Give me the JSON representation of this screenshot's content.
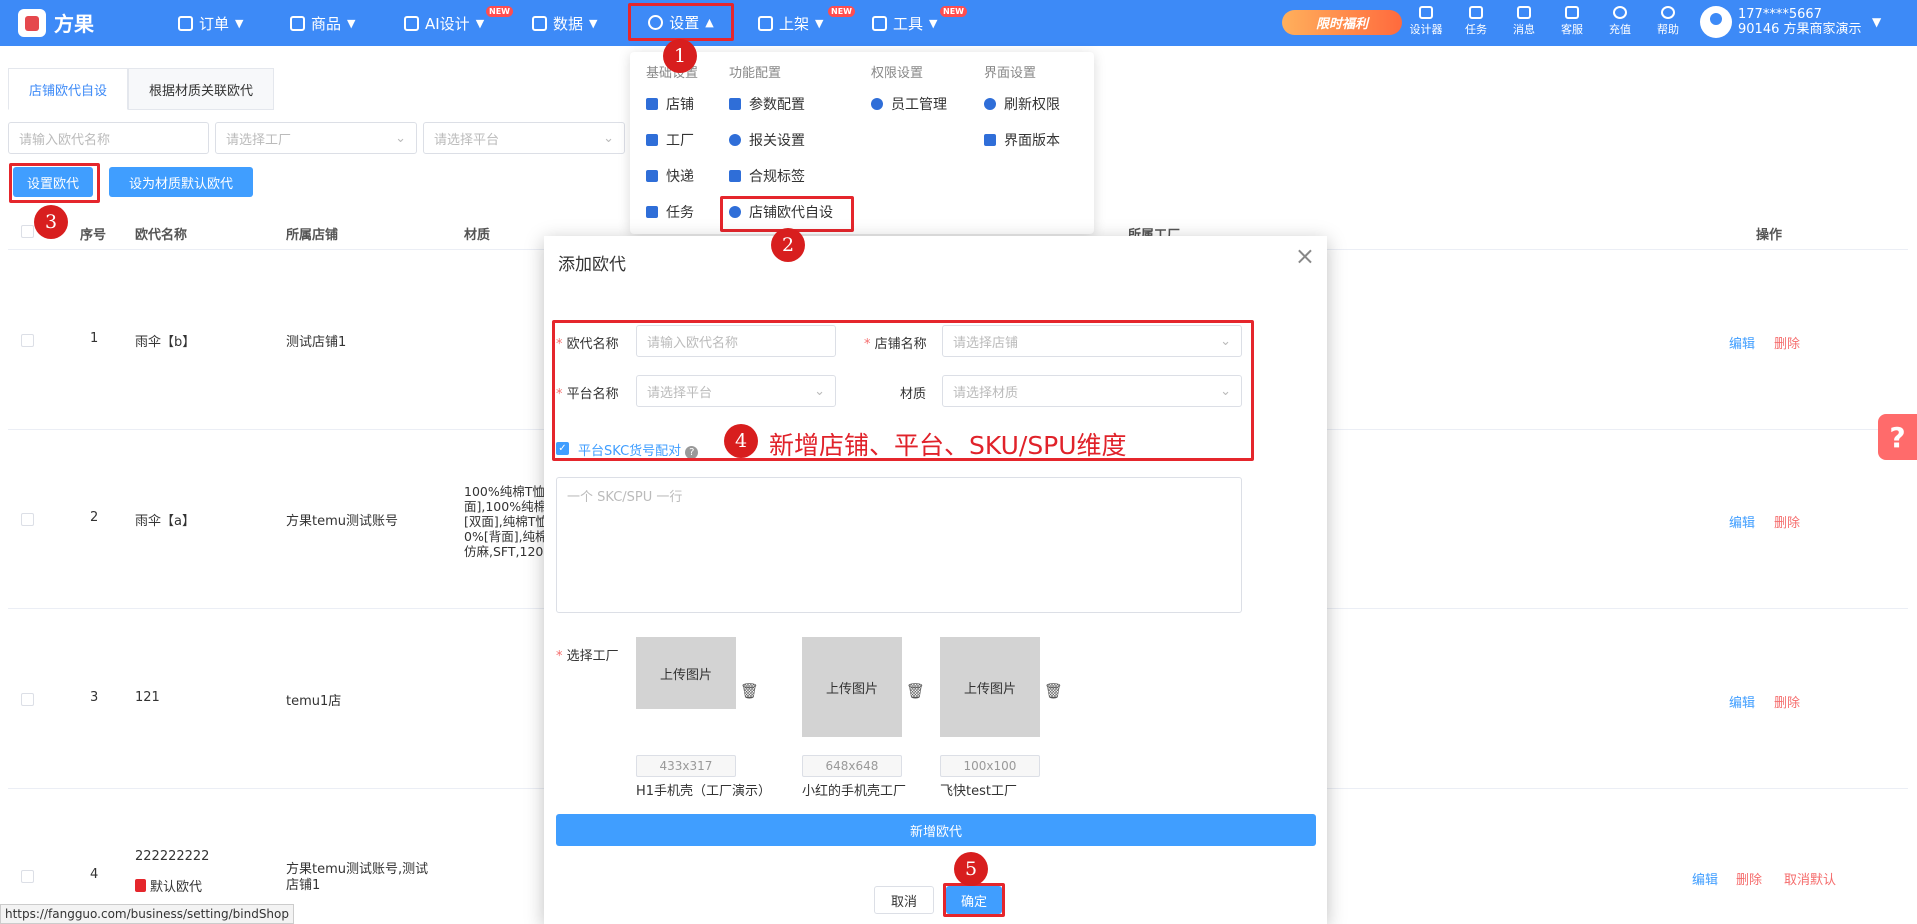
{
  "app": {
    "name": "方果"
  },
  "nav": {
    "orders": "订单",
    "products": "商品",
    "ai_design": "AI设计",
    "data": "数据",
    "settings": "设置",
    "listing": "上架",
    "tools": "工具",
    "new_badge": "NEW"
  },
  "promo": {
    "label": "限时福利"
  },
  "toolbar": {
    "designer": "设计器",
    "tasks": "任务",
    "messages": "消息",
    "service": "客服",
    "recharge": "充值",
    "help": "帮助"
  },
  "user": {
    "phone": "177****5667",
    "account": "90146 方果商家演示"
  },
  "tabs": [
    "店铺欧代自设",
    "根据材质关联欧代"
  ],
  "filters": {
    "name_placeholder": "请输入欧代名称",
    "factory_placeholder": "请选择工厂",
    "platform_placeholder": "请选择平台"
  },
  "buttons": {
    "set_rep": "设置欧代",
    "set_default": "设为材质默认欧代"
  },
  "table": {
    "headers": {
      "index": "序号",
      "name": "欧代名称",
      "shop": "所属店铺",
      "material": "材质",
      "factory": "所属工厂",
      "actions": "操作"
    },
    "rows": [
      {
        "index": "1",
        "name": "雨伞【b】",
        "shop": "测试店铺1",
        "material": ""
      },
      {
        "index": "2",
        "name": "雨伞【a】",
        "shop": "方果temu测试账号",
        "material_lines": [
          "100%纯棉T恤",
          "面],100%纯棉",
          "[双面],纯棉T恤",
          "0%[背面],纯棉",
          "仿麻,SFT,120"
        ]
      },
      {
        "index": "3",
        "name": "121",
        "shop": "temu1店",
        "material": ""
      },
      {
        "index": "4",
        "name": "222222222",
        "default_label": "默认欧代",
        "shop_lines": [
          "方果temu测试账号,测试",
          "店铺1"
        ]
      }
    ],
    "actions": {
      "edit": "编辑",
      "delete": "删除",
      "cancel_default": "取消默认"
    }
  },
  "settings_menu": {
    "headers": {
      "basic": "基础设置",
      "feature": "功能配置",
      "permission": "权限设置",
      "interface": "界面设置"
    },
    "basic": [
      "店铺",
      "工厂",
      "快递",
      "任务"
    ],
    "feature": [
      "参数配置",
      "报关设置",
      "合规标签",
      "店铺欧代自设"
    ],
    "permission": [
      "员工管理"
    ],
    "interface": [
      "刷新权限",
      "界面版本"
    ]
  },
  "modal": {
    "title": "添加欧代",
    "rep_name_label": "欧代名称",
    "rep_name_placeholder": "请输入欧代名称",
    "shop_label": "店铺名称",
    "shop_placeholder": "请选择店铺",
    "platform_label": "平台名称",
    "platform_placeholder": "请选择平台",
    "material_label": "材质",
    "material_placeholder": "请选择材质",
    "skc_checkbox": "平台SKC货号配对",
    "skc_placeholder": "一个 SKC/SPU 一行",
    "factory_label": "选择工厂",
    "factories": [
      {
        "upload": "上传图片",
        "size": "433x317",
        "name": "H1手机壳（工厂演示）"
      },
      {
        "upload": "上传图片",
        "size": "648x648",
        "name": "小红的手机壳工厂"
      },
      {
        "upload": "上传图片",
        "size": "100x100",
        "name": "飞快test工厂"
      }
    ],
    "add_button": "新增欧代",
    "cancel": "取消",
    "confirm": "确定"
  },
  "annotation": {
    "text": "新增店铺、平台、SKU/SPU维度"
  },
  "markers": [
    "1",
    "2",
    "3",
    "4",
    "5"
  ],
  "status_url": "https://fangguo.com/business/setting/bindShop",
  "colors": {
    "primary": "#3d8af7",
    "button": "#409eff",
    "highlight": "#e5262c",
    "danger": "#f56c6c"
  }
}
